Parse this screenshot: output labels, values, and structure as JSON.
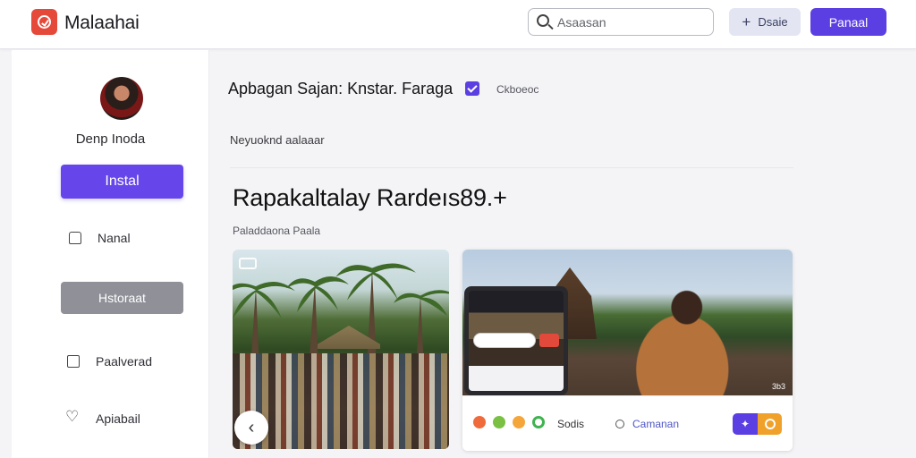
{
  "app": {
    "title": "Malaahai"
  },
  "search": {
    "placeholder": "Asaasan"
  },
  "header": {
    "ghost_label": "Dsaie",
    "primary_label": "Panaal"
  },
  "sidebar": {
    "user_name": "Denp Inoda",
    "install_label": "Instal",
    "items": [
      {
        "label": "Nanal",
        "icon": "bag-icon"
      },
      {
        "label": "Hstoraat",
        "icon": "none"
      },
      {
        "label": "Paalverad",
        "icon": "square-icon"
      },
      {
        "label": "Apiabail",
        "icon": "heart-icon"
      }
    ]
  },
  "main": {
    "title": "Apbagan Sajan: Knstar. Faraga",
    "checkbox_label": "Ckboeoc",
    "subheading": "Neyuoknd aalaaar",
    "heading": "Rapakaltalay Rardeıs89.+",
    "caption": "Paladdaona Paala"
  },
  "card2": {
    "badge": "3b3",
    "name_label": "Sodis",
    "comment_label": "Camanan",
    "dot_colors": [
      "#f06b3c",
      "#7ac143",
      "#f5a63a",
      "#3fb34f"
    ]
  }
}
